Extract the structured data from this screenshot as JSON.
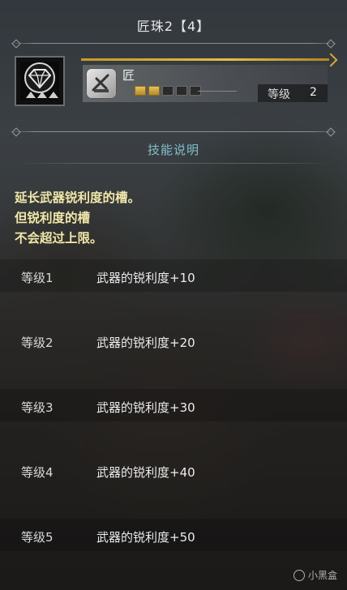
{
  "header": {
    "title": "匠珠2【4】"
  },
  "item": {
    "icon": "diamond-jewel-icon",
    "skill_icon": "sword-skill-icon",
    "skill_name": "匠",
    "slots_filled": 2,
    "slots_total": 5,
    "level_label": "等级",
    "level_value": "2",
    "accent": "#d6aa38"
  },
  "section": {
    "title": "技能说明"
  },
  "description": {
    "lines": [
      "延长武器锐利度的槽。",
      "但锐利度的槽",
      "不会超过上限。"
    ],
    "color": "#f1e7a8"
  },
  "levels": [
    {
      "name": "等级1",
      "text": "武器的锐利度+10"
    },
    {
      "name": "等级2",
      "text": "武器的锐利度+20"
    },
    {
      "name": "等级3",
      "text": "武器的锐利度+30"
    },
    {
      "name": "等级4",
      "text": "武器的锐利度+40"
    },
    {
      "name": "等级5",
      "text": "武器的锐利度+50"
    }
  ],
  "watermark": {
    "text": "小黑盒"
  },
  "colors": {
    "section_title": "#7fc0c7"
  }
}
